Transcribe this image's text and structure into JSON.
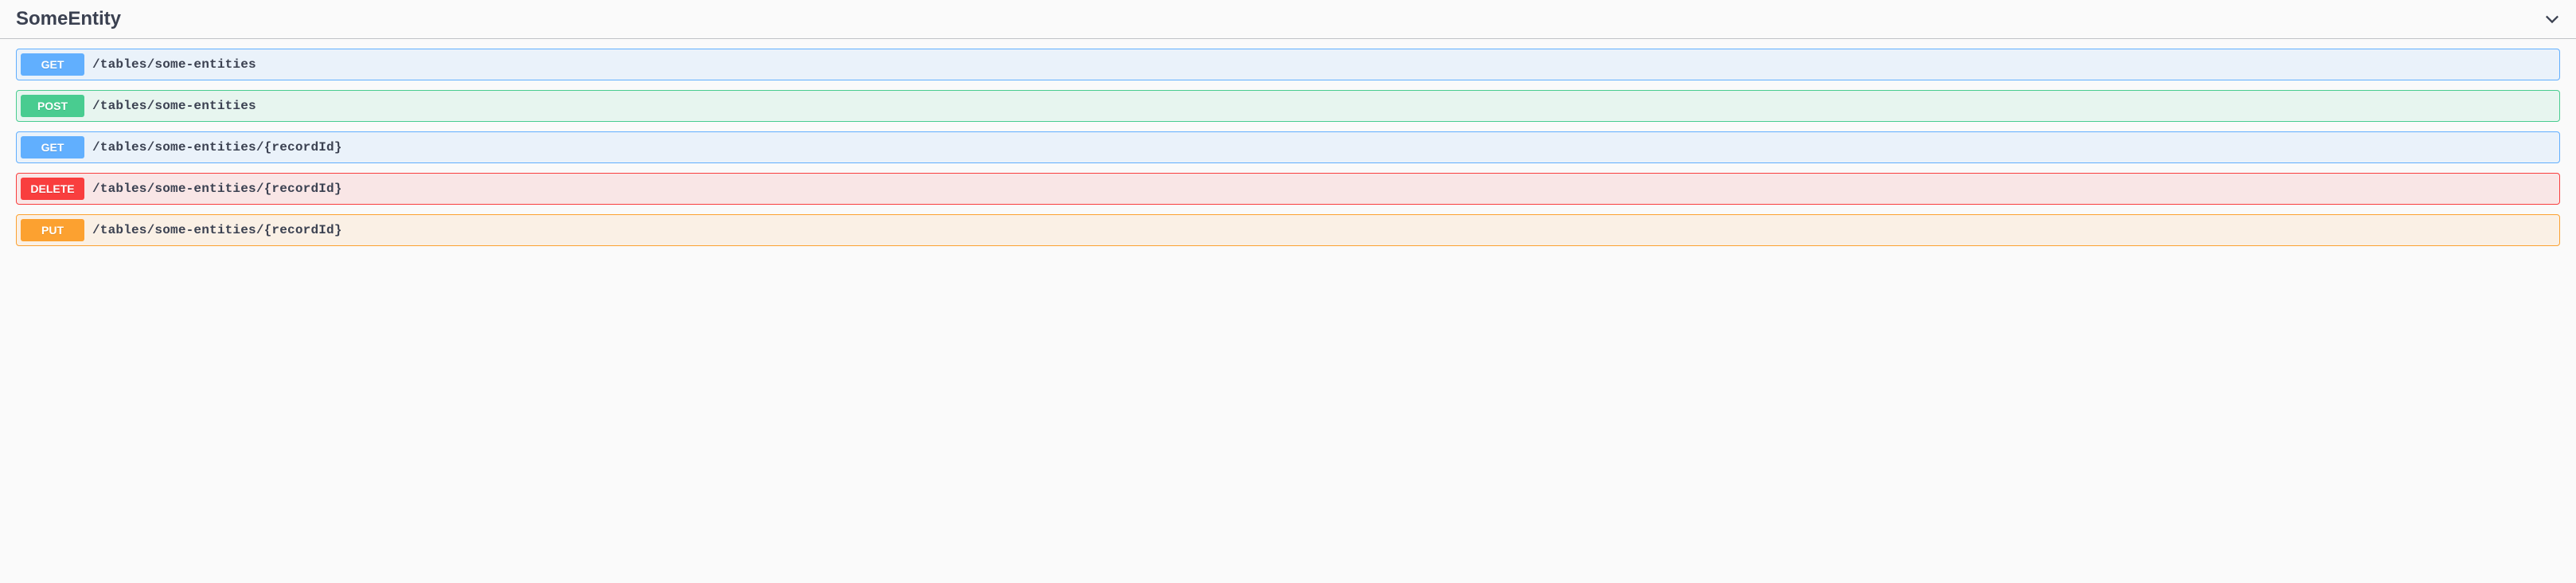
{
  "tag": {
    "name": "SomeEntity"
  },
  "operations": [
    {
      "method": "GET",
      "methodClass": "get",
      "path": "/tables/some-entities"
    },
    {
      "method": "POST",
      "methodClass": "post",
      "path": "/tables/some-entities"
    },
    {
      "method": "GET",
      "methodClass": "get",
      "path": "/tables/some-entities/{recordId}"
    },
    {
      "method": "DELETE",
      "methodClass": "delete",
      "path": "/tables/some-entities/{recordId}"
    },
    {
      "method": "PUT",
      "methodClass": "put",
      "path": "/tables/some-entities/{recordId}"
    }
  ]
}
